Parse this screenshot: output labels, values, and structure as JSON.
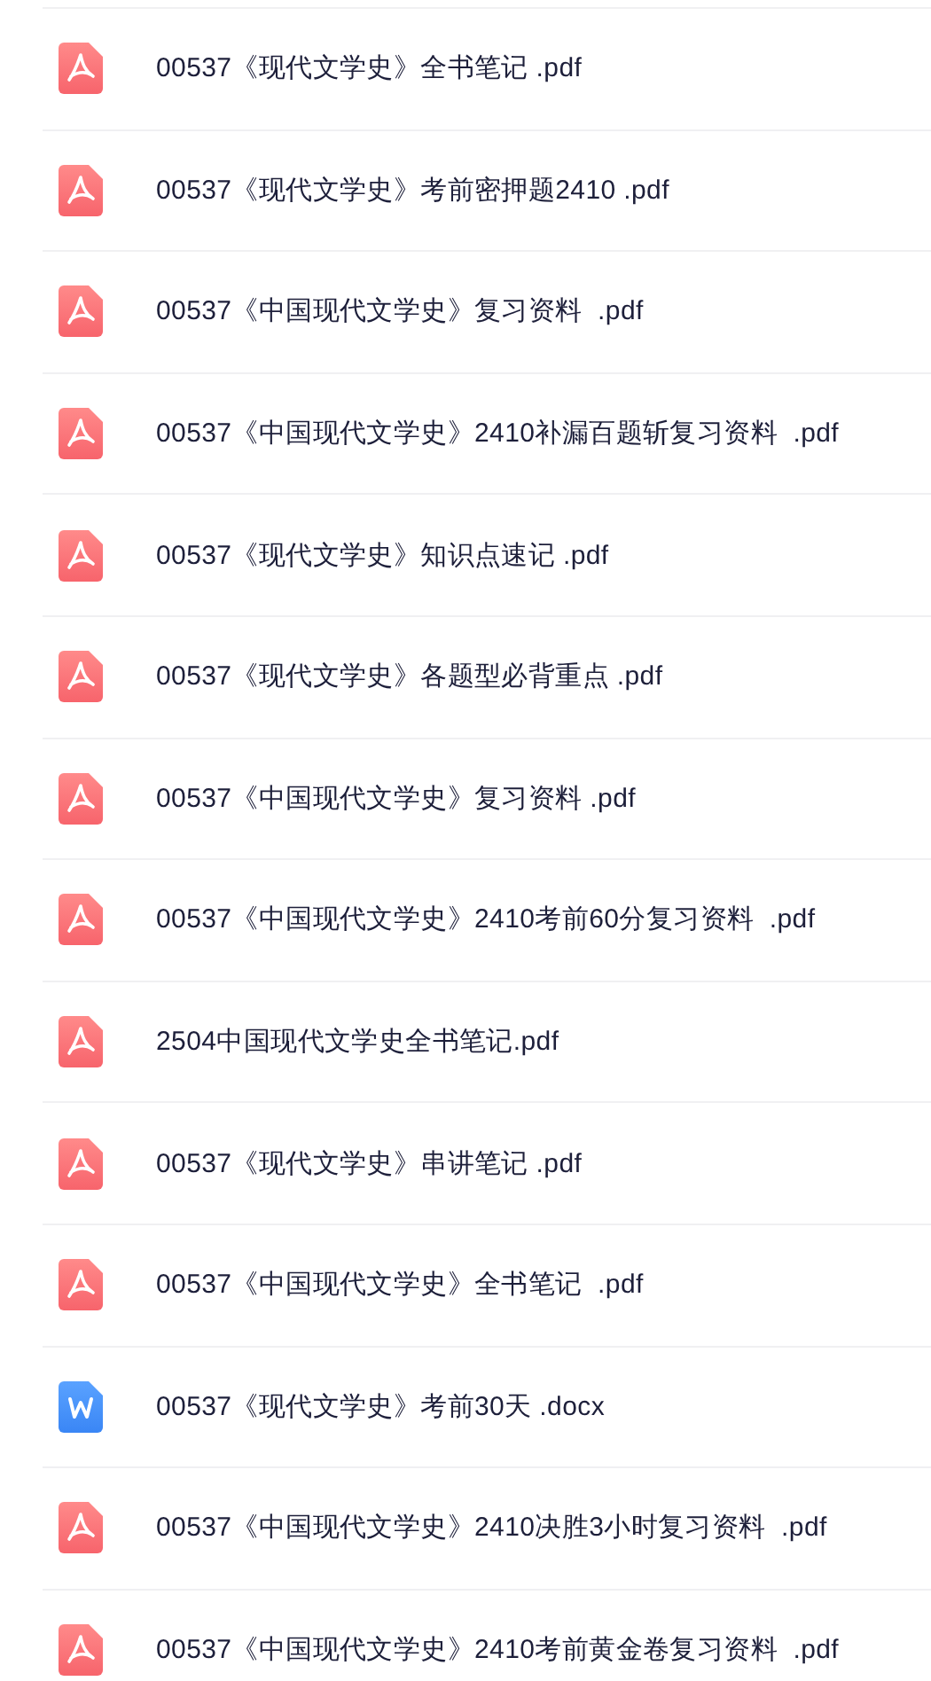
{
  "files": [
    {
      "kind": "pdf",
      "name": "00537《现代文学史》全书笔记 .pdf"
    },
    {
      "kind": "pdf",
      "name": "00537《现代文学史》考前密押题2410 .pdf"
    },
    {
      "kind": "pdf",
      "name": "00537《中国现代文学史》复习资料  .pdf"
    },
    {
      "kind": "pdf",
      "name": "00537《中国现代文学史》2410补漏百题斩复习资料  .pdf"
    },
    {
      "kind": "pdf",
      "name": "00537《现代文学史》知识点速记 .pdf"
    },
    {
      "kind": "pdf",
      "name": "00537《现代文学史》各题型必背重点 .pdf"
    },
    {
      "kind": "pdf",
      "name": "00537《中国现代文学史》复习资料 .pdf"
    },
    {
      "kind": "pdf",
      "name": "00537《中国现代文学史》2410考前60分复习资料  .pdf"
    },
    {
      "kind": "pdf",
      "name": "2504中国现代文学史全书笔记.pdf"
    },
    {
      "kind": "pdf",
      "name": "00537《现代文学史》串讲笔记 .pdf"
    },
    {
      "kind": "pdf",
      "name": "00537《中国现代文学史》全书笔记  .pdf"
    },
    {
      "kind": "docx",
      "name": "00537《现代文学史》考前30天 .docx"
    },
    {
      "kind": "pdf",
      "name": "00537《中国现代文学史》2410决胜3小时复习资料  .pdf"
    },
    {
      "kind": "pdf",
      "name": "00537《中国现代文学史》2410考前黄金卷复习资料  .pdf"
    }
  ]
}
